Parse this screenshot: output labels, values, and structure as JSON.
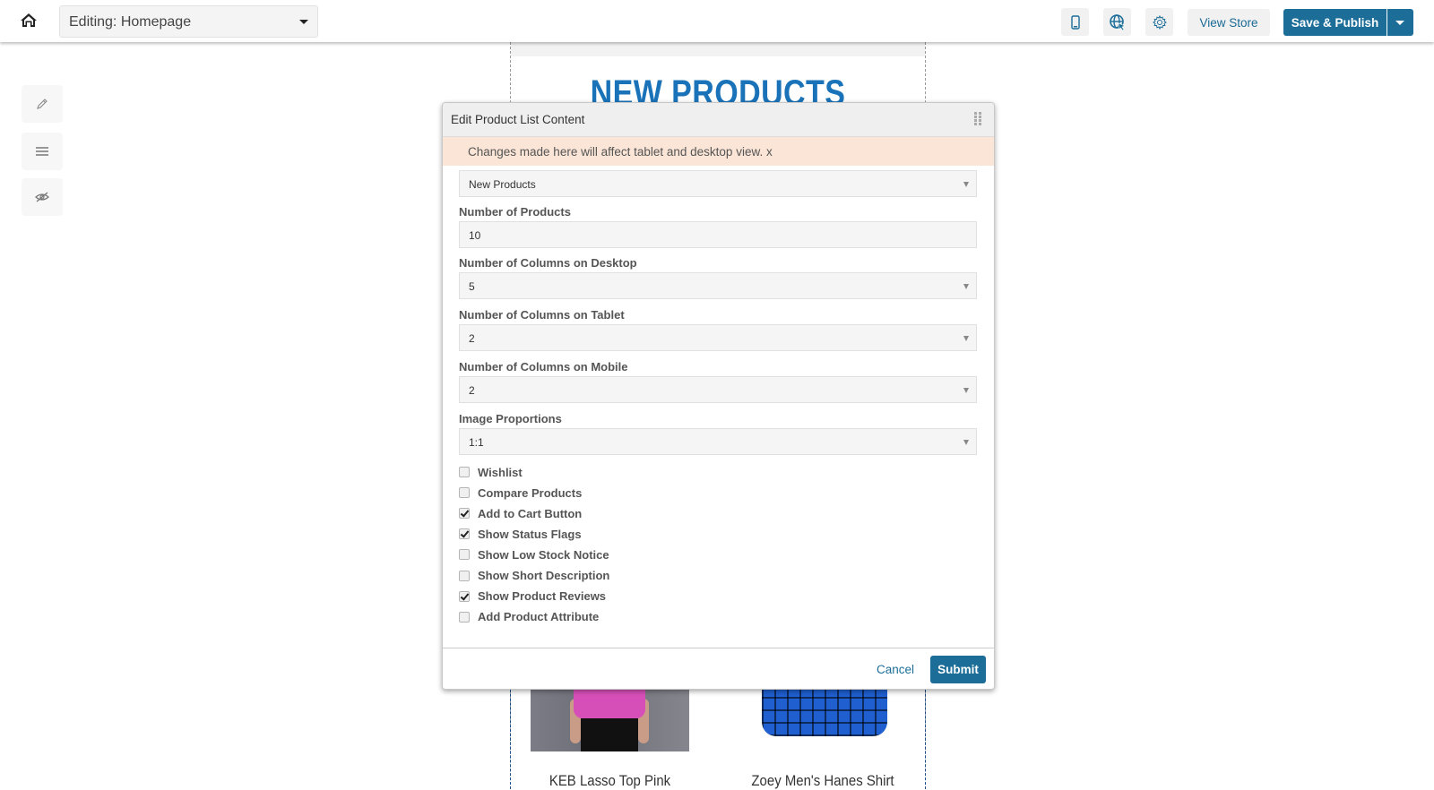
{
  "topbar": {
    "home_icon": "home-icon",
    "page_selector": "Editing: Homepage",
    "mobile_icon": "mobile-device-icon",
    "globe_icon": "globe-cursor-icon",
    "settings_icon": "gear-icon",
    "view_store": "View Store",
    "save_publish": "Save & Publish"
  },
  "toolbox": {
    "items": [
      {
        "icon": "pencil-icon"
      },
      {
        "icon": "menu-lines-icon"
      },
      {
        "icon": "eye-slash-icon"
      }
    ]
  },
  "canvas": {
    "section_title": "NEW PRODUCTS",
    "products": [
      {
        "name": "KEB Lasso Top Pink"
      },
      {
        "name": "Zoey Men's Hanes Shirt"
      }
    ]
  },
  "modal": {
    "title": "Edit Product List Content",
    "notice": "Changes made here will affect tablet and desktop view.",
    "notice_close": "x",
    "fields": [
      {
        "label": "",
        "value": "New Products",
        "type": "select"
      },
      {
        "label": "Number of Products",
        "value": "10",
        "type": "input"
      },
      {
        "label": "Number of Columns on Desktop",
        "value": "5",
        "type": "select"
      },
      {
        "label": "Number of Columns on Tablet",
        "value": "2",
        "type": "select"
      },
      {
        "label": "Number of Columns on Mobile",
        "value": "2",
        "type": "select"
      },
      {
        "label": "Image Proportions",
        "value": "1:1",
        "type": "select"
      }
    ],
    "checkboxes": [
      {
        "label": "Wishlist",
        "checked": false
      },
      {
        "label": "Compare Products",
        "checked": false
      },
      {
        "label": "Add to Cart Button",
        "checked": true
      },
      {
        "label": "Show Status Flags",
        "checked": true
      },
      {
        "label": "Show Low Stock Notice",
        "checked": false
      },
      {
        "label": "Show Short Description",
        "checked": false
      },
      {
        "label": "Show Product Reviews",
        "checked": true
      },
      {
        "label": "Add Product Attribute",
        "checked": false
      }
    ],
    "cancel": "Cancel",
    "submit": "Submit"
  },
  "colors": {
    "primary": "#1c6e99",
    "notice_bg": "#fbe5d6",
    "title_blue": "#1a73b8"
  }
}
